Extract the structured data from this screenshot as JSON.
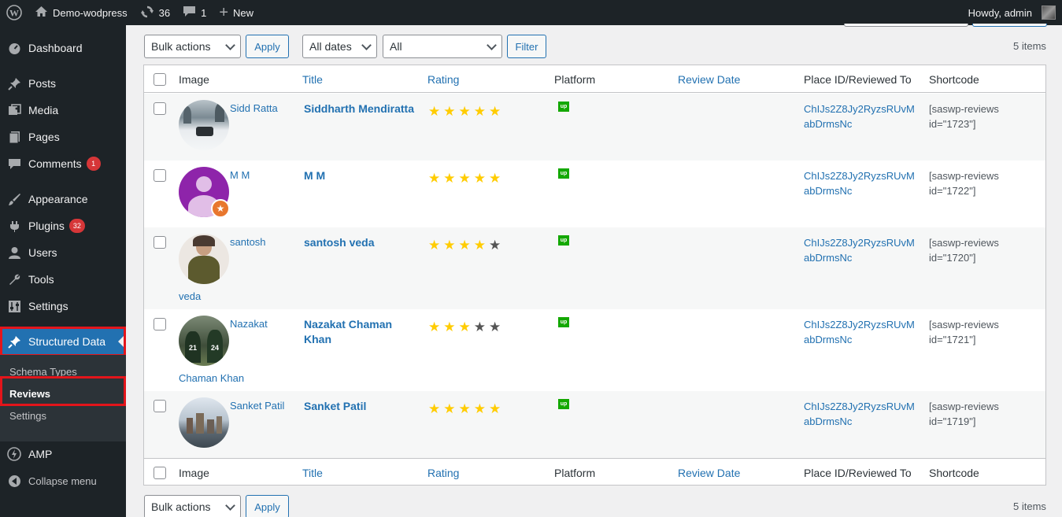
{
  "adminbar": {
    "site_name": "Demo-wodpress",
    "updates_count": "36",
    "comments_count": "1",
    "new_label": "New",
    "greeting": "Howdy, admin"
  },
  "sidebar": {
    "items": [
      {
        "label": "Dashboard",
        "icon": "dashboard-icon"
      },
      {
        "label": "Posts",
        "icon": "pin-icon"
      },
      {
        "label": "Media",
        "icon": "media-icon"
      },
      {
        "label": "Pages",
        "icon": "pages-icon"
      },
      {
        "label": "Comments",
        "icon": "comments-icon",
        "badge": "1"
      },
      {
        "label": "Appearance",
        "icon": "brush-icon"
      },
      {
        "label": "Plugins",
        "icon": "plugin-icon",
        "badge": "32"
      },
      {
        "label": "Users",
        "icon": "user-icon"
      },
      {
        "label": "Tools",
        "icon": "wrench-icon"
      },
      {
        "label": "Settings",
        "icon": "settings-icon"
      },
      {
        "label": "Structured Data",
        "icon": "pin-icon"
      },
      {
        "label": "AMP",
        "icon": "amp-icon"
      },
      {
        "label": "Collapse menu",
        "icon": "collapse-icon"
      }
    ],
    "submenu": [
      "Schema Types",
      "Reviews",
      "Settings"
    ],
    "accent": "#2271b1",
    "highlight": "#e3151b"
  },
  "toolbar": {
    "bulk_actions": "Bulk actions",
    "apply": "Apply",
    "dates": "All dates",
    "all": "All",
    "filter": "Filter",
    "items_count": "5 items"
  },
  "table": {
    "columns": [
      "Image",
      "Title",
      "Rating",
      "Platform",
      "Review Date",
      "Place ID/Reviewed To",
      "Shortcode"
    ],
    "rows": [
      {
        "name1": "Sidd Ratta",
        "name2": "",
        "title": "Siddharth Mendiratta",
        "rating": 5,
        "place": "ChIJs2Z8Jy2RyzsRUvMabDrmsNc",
        "shortcode": "[saswp-reviews id=\"1723\"]",
        "platform": "up"
      },
      {
        "name1": "M M",
        "name2": "",
        "title": "M M",
        "rating": 5,
        "place": "ChIJs2Z8Jy2RyzsRUvMabDrmsNc",
        "shortcode": "[saswp-reviews id=\"1722\"]",
        "platform": "up"
      },
      {
        "name1": "santosh",
        "name2": "veda",
        "title": "santosh veda",
        "rating": 4,
        "place": "ChIJs2Z8Jy2RyzsRUvMabDrmsNc",
        "shortcode": "[saswp-reviews id=\"1720\"]",
        "platform": "up"
      },
      {
        "name1": "Nazakat",
        "name2": "Chaman Khan",
        "title": "Nazakat Chaman Khan",
        "rating": 3,
        "place": "ChIJs2Z8Jy2RyzsRUvMabDrmsNc",
        "shortcode": "[saswp-reviews id=\"1721\"]",
        "platform": "up"
      },
      {
        "name1": "Sanket Patil",
        "name2": "",
        "title": "Sanket Patil",
        "rating": 5,
        "place": "ChIJs2Z8Jy2RyzsRUvMabDrmsNc",
        "shortcode": "[saswp-reviews id=\"1719\"]",
        "platform": "up"
      }
    ]
  }
}
